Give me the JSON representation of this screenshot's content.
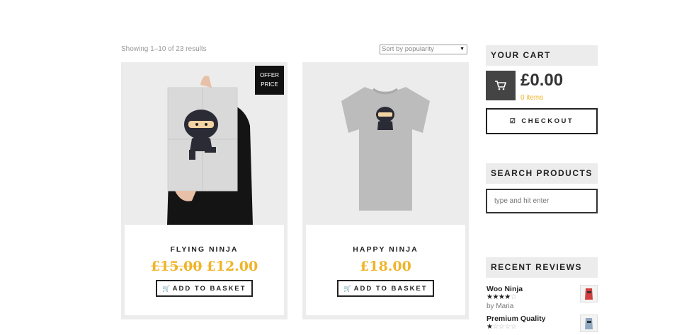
{
  "toolbar": {
    "results_text": "Showing 1–10 of 23 results",
    "sort_selected": "Sort by popularity",
    "sort_arrow": "▼"
  },
  "products": [
    {
      "name": "FLYING NINJA",
      "old_price": "£15.00",
      "price": "£12.00",
      "badge_line1": "OFFER",
      "badge_line2": "PRICE",
      "button_label": "ADD TO BASKET"
    },
    {
      "name": "HAPPY NINJA",
      "price": "£18.00",
      "button_label": "ADD TO BASKET"
    }
  ],
  "sidebar": {
    "cart": {
      "title": "YOUR CART",
      "total": "£0.00",
      "items": "0 items",
      "checkout_label": "CHECKOUT"
    },
    "search": {
      "title": "SEARCH PRODUCTS",
      "placeholder": "type and hit enter"
    },
    "reviews": {
      "title": "RECENT REVIEWS",
      "items": [
        {
          "product": "Woo Ninja",
          "rating": 4,
          "author": "by Maria"
        },
        {
          "product": "Premium Quality",
          "rating": 1
        }
      ]
    }
  },
  "colors": {
    "accent": "#f0b429",
    "panel": "#ececec",
    "dark": "#222222"
  }
}
